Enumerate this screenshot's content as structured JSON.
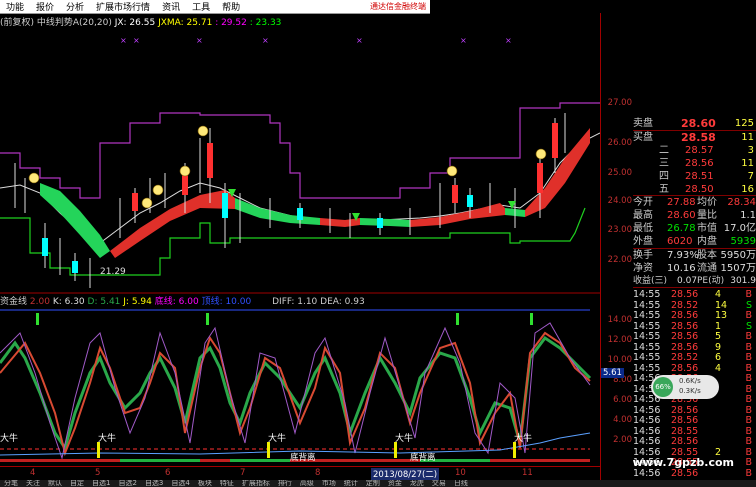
{
  "menu": {
    "items": [
      "功能",
      "报价",
      "分析",
      "扩展市场行情",
      "资讯",
      "工具",
      "帮助"
    ],
    "notice": "通达信金融终端"
  },
  "main_chart": {
    "indicator_line": {
      "prefix": "(前复权) 中线判势A(20,20)",
      "jx": "JX: 26.55",
      "jxma": "JXMA: 25.71",
      "v1": ": 29.52",
      "v2": ": 23.33"
    },
    "low_label": "21.29",
    "yticks": [
      "27.00",
      "26.00",
      "25.00",
      "24.00",
      "23.00",
      "22.00"
    ]
  },
  "lower_chart": {
    "indicator_line": {
      "name": "资金线",
      "a": "2.00",
      "k": "K: 6.30",
      "d": "D: 5.41",
      "j": "J: 5.94",
      "b": "底线: 6.00",
      "t": "顶线: 10.00",
      "diff": "DIFF: 1.10",
      "dea": "DEA: 0.93"
    },
    "yticks": [
      "14.00",
      "12.00",
      "10.00",
      "8.00",
      "6.00",
      "4.00",
      "2.00"
    ],
    "marker": "5.61",
    "labels": [
      "大牛",
      "大牛",
      "大牛",
      "大牛",
      "大牛",
      "底背离",
      "底背离"
    ]
  },
  "xaxis": {
    "labels": [
      "4",
      "5",
      "6",
      "7",
      "8",
      "9",
      "10",
      "11"
    ],
    "date": "2013/08/27(二)"
  },
  "quote": {
    "sell_label": "卖盘",
    "sell_price": "28.60",
    "sell_vol": "125",
    "buy_label": "买盘",
    "buy_price": "28.58",
    "buy_vol": "11",
    "levels": [
      {
        "label": "二",
        "price": "28.57",
        "vol": "3"
      },
      {
        "label": "三",
        "price": "28.56",
        "vol": "11"
      },
      {
        "label": "四",
        "price": "28.51",
        "vol": "7"
      },
      {
        "label": "五",
        "price": "28.50",
        "vol": "16"
      }
    ],
    "stats": [
      {
        "l1": "今开",
        "v1": "27.88",
        "l2": "均价",
        "v2": "28.34"
      },
      {
        "l1": "最高",
        "v1": "28.60",
        "l2": "量比",
        "v2": "1.1"
      },
      {
        "l1": "最低",
        "v1": "26.78",
        "l2": "市值",
        "v2": "17.0亿"
      },
      {
        "l1": "外盘",
        "v1": "6020",
        "l2": "内盘",
        "v2": "5939"
      },
      {
        "l1": "换手",
        "v1": "7.93%",
        "l2": "股本",
        "v2": "5950万"
      },
      {
        "l1": "净资",
        "v1": "10.16",
        "l2": "流通",
        "v2": "1507万"
      },
      {
        "l1": "收益(三)",
        "v1": "0.07",
        "l2": "PE(动)",
        "v2": "301.9"
      }
    ],
    "trades": [
      {
        "t": "14:55",
        "p": "28.56",
        "v": "4",
        "s": "B"
      },
      {
        "t": "14:55",
        "p": "28.52",
        "v": "14",
        "s": "S"
      },
      {
        "t": "14:55",
        "p": "28.56",
        "v": "13",
        "s": "B"
      },
      {
        "t": "14:55",
        "p": "28.56",
        "v": "1",
        "s": "S"
      },
      {
        "t": "14:55",
        "p": "28.56",
        "v": "5",
        "s": "B"
      },
      {
        "t": "14:55",
        "p": "28.56",
        "v": "9",
        "s": "B"
      },
      {
        "t": "14:55",
        "p": "28.52",
        "v": "6",
        "s": "B"
      },
      {
        "t": "14:55",
        "p": "28.56",
        "v": "4",
        "s": "B"
      },
      {
        "t": "14:56",
        "p": "28.56",
        "v": "",
        "s": "B"
      },
      {
        "t": "14:56",
        "p": "28.56",
        "v": "",
        "s": "B"
      },
      {
        "t": "14:56",
        "p": "28.56",
        "v": "",
        "s": "B"
      },
      {
        "t": "14:56",
        "p": "28.56",
        "v": "",
        "s": "B"
      },
      {
        "t": "14:56",
        "p": "28.56",
        "v": "",
        "s": "B"
      },
      {
        "t": "14:56",
        "p": "28.55",
        "v": "",
        "s": "B"
      },
      {
        "t": "14:56",
        "p": "28.56",
        "v": "",
        "s": "B"
      },
      {
        "t": "14:56",
        "p": "28.55",
        "v": "2",
        "s": "B"
      },
      {
        "t": "14:56",
        "p": "28.55",
        "v": "",
        "s": "B"
      },
      {
        "t": "14:56",
        "p": "28.56",
        "v": "",
        "s": "B"
      }
    ]
  },
  "speed": {
    "pct": "66%",
    "up": "0.6K/s",
    "down": "0.3K/s"
  },
  "watermark": "www.7gpzb.com",
  "bottom_tabs": [
    "分笔",
    "关注",
    "默认",
    "自定",
    "自选1",
    "自选2",
    "自选3",
    "自选4",
    "板块",
    "特征",
    "扩展指标",
    "排行",
    "高级",
    "市场",
    "统计",
    "定制",
    "资金",
    "龙虎",
    "交易",
    "日线"
  ]
}
